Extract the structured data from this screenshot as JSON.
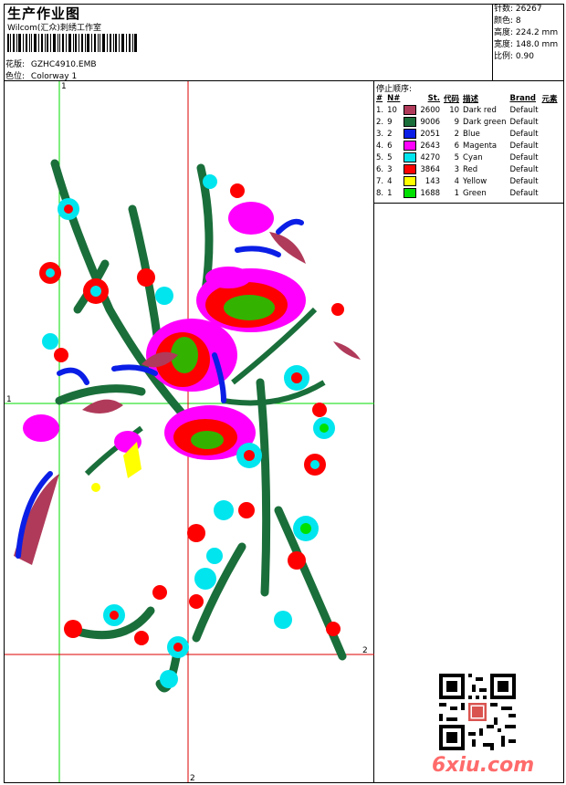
{
  "header": {
    "title": "生产作业图",
    "company": "Wilcom(汇众)刺绣工作室",
    "file_label": "花版:",
    "file_value": "GZHC4910.EMB",
    "colorway_label": "色位:",
    "colorway_value": "Colorway 1"
  },
  "stats": [
    {
      "label": "针数:",
      "value": "26267"
    },
    {
      "label": "颜色:",
      "value": "8"
    },
    {
      "label": "高度:",
      "value": "224.2 mm"
    },
    {
      "label": "宽度:",
      "value": "148.0 mm"
    },
    {
      "label": "比例:",
      "value": "0.90"
    }
  ],
  "sequence": {
    "title": "停止顺序:",
    "headers": [
      "#",
      "N#",
      "St.",
      "代码",
      "描述",
      "Brand",
      "元素"
    ],
    "rows": [
      {
        "num": "1.",
        "n": "10",
        "st": "2600",
        "code": "10",
        "desc": "Dark red",
        "brand": "Default",
        "color": "#b03a5a"
      },
      {
        "num": "2.",
        "n": "9",
        "st": "9006",
        "code": "9",
        "desc": "Dark green",
        "brand": "Default",
        "color": "#1a6e3a"
      },
      {
        "num": "3.",
        "n": "2",
        "st": "2051",
        "code": "2",
        "desc": "Blue",
        "brand": "Default",
        "color": "#0a1ee6"
      },
      {
        "num": "4.",
        "n": "6",
        "st": "2643",
        "code": "6",
        "desc": "Magenta",
        "brand": "Default",
        "color": "#ff00ff"
      },
      {
        "num": "5.",
        "n": "5",
        "st": "4270",
        "code": "5",
        "desc": "Cyan",
        "brand": "Default",
        "color": "#00e5ee"
      },
      {
        "num": "6.",
        "n": "3",
        "st": "3864",
        "code": "3",
        "desc": "Red",
        "brand": "Default",
        "color": "#ff0000"
      },
      {
        "num": "7.",
        "n": "4",
        "st": "143",
        "code": "4",
        "desc": "Yellow",
        "brand": "Default",
        "color": "#ffff00"
      },
      {
        "num": "8.",
        "n": "1",
        "st": "1688",
        "code": "1",
        "desc": "Green",
        "brand": "Default",
        "color": "#00e000"
      }
    ]
  },
  "axes": {
    "top_marker": "1",
    "left_marker": "1",
    "right_marker": "2",
    "bottom_marker": "2"
  },
  "watermark": "6xiu.com"
}
